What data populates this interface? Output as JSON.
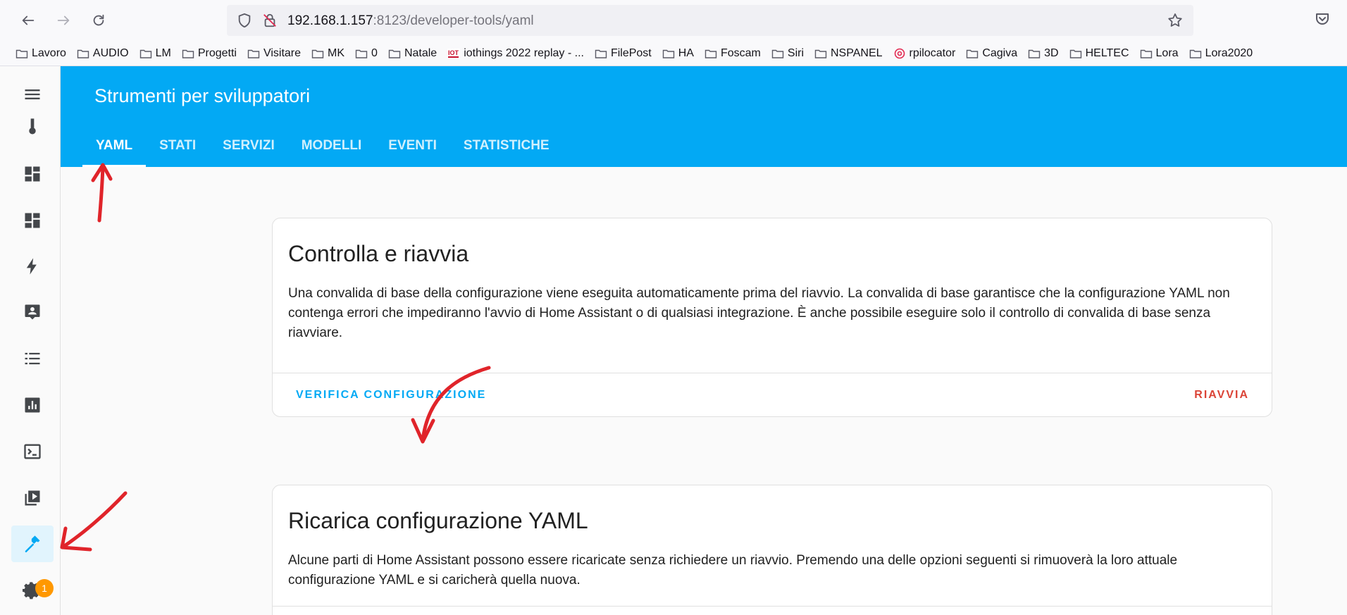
{
  "browser": {
    "url_host": "192.168.1.157",
    "url_path": ":8123/developer-tools/yaml",
    "back_icon": "arrow-left-icon",
    "forward_icon": "arrow-right-icon",
    "reload_icon": "reload-icon",
    "bookmark_star_icon": "star-icon",
    "pocket_icon": "pocket-icon"
  },
  "bookmarks": [
    {
      "label": "Lavoro",
      "icon": "folder-icon"
    },
    {
      "label": "AUDIO",
      "icon": "folder-icon"
    },
    {
      "label": "LM",
      "icon": "folder-icon"
    },
    {
      "label": "Progetti",
      "icon": "folder-icon"
    },
    {
      "label": "Visitare",
      "icon": "folder-icon"
    },
    {
      "label": "MK",
      "icon": "folder-icon"
    },
    {
      "label": "0",
      "icon": "folder-icon"
    },
    {
      "label": "Natale",
      "icon": "folder-icon"
    },
    {
      "label": "iothings 2022 replay - ...",
      "icon": "iot-logo-icon"
    },
    {
      "label": "FilePost",
      "icon": "folder-icon"
    },
    {
      "label": "HA",
      "icon": "folder-icon"
    },
    {
      "label": "Foscam",
      "icon": "folder-icon"
    },
    {
      "label": "Siri",
      "icon": "folder-icon"
    },
    {
      "label": "NSPANEL",
      "icon": "folder-icon"
    },
    {
      "label": "rpilocator",
      "icon": "target-icon"
    },
    {
      "label": "Cagiva",
      "icon": "folder-icon"
    },
    {
      "label": "3D",
      "icon": "folder-icon"
    },
    {
      "label": "HELTEC",
      "icon": "folder-icon"
    },
    {
      "label": "Lora",
      "icon": "folder-icon"
    },
    {
      "label": "Lora2020",
      "icon": "folder-icon"
    }
  ],
  "sidebar": {
    "items": [
      {
        "name": "menu-icon"
      },
      {
        "name": "thermometer-icon"
      },
      {
        "name": "dashboard-icon"
      },
      {
        "name": "dashboard-icon"
      },
      {
        "name": "lightning-bolt-icon"
      },
      {
        "name": "account-box-icon"
      },
      {
        "name": "format-list-icon"
      },
      {
        "name": "chart-box-icon"
      },
      {
        "name": "console-icon"
      },
      {
        "name": "play-box-multiple-icon"
      },
      {
        "name": "hammer-icon",
        "active": true
      },
      {
        "name": "gear-icon"
      }
    ],
    "notification_count": "1"
  },
  "header": {
    "title": "Strumenti per sviluppatori",
    "tabs": [
      {
        "label": "YAML",
        "active": true
      },
      {
        "label": "STATI"
      },
      {
        "label": "SERVIZI"
      },
      {
        "label": "MODELLI"
      },
      {
        "label": "EVENTI"
      },
      {
        "label": "STATISTICHE"
      }
    ]
  },
  "cards": {
    "check": {
      "title": "Controlla e riavvia",
      "text": "Una convalida di base della configurazione viene eseguita automaticamente prima del riavvio. La convalida di base garantisce che la configurazione YAML non contenga errori che impediranno l'avvio di Home Assistant o di qualsiasi integrazione. È anche possibile eseguire solo il controllo di convalida di base senza riavviare.",
      "verify_label": "VERIFICA CONFIGURAZIONE",
      "restart_label": "RIAVVIA"
    },
    "reload": {
      "title": "Ricarica configurazione YAML",
      "text": "Alcune parti di Home Assistant possono essere ricaricate senza richiedere un riavvio. Premendo una delle opzioni seguenti si rimuoverà la loro attuale configurazione YAML e si caricherà quella nuova."
    }
  },
  "colors": {
    "primary": "#03a9f4",
    "restart": "#db4437",
    "badge": "#ff9800",
    "annotation": "#e0242a"
  }
}
